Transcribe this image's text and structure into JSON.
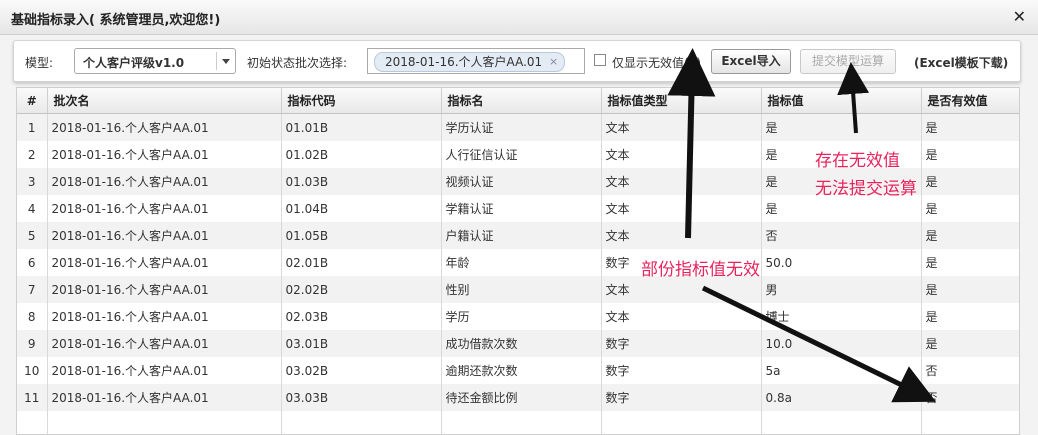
{
  "window": {
    "title": "基础指标录入( 系统管理员,欢迎您!)",
    "close_label": "✕"
  },
  "toolbar": {
    "model_label": "模型:",
    "model_value": "个人客户评级v1.0",
    "batch_label": "初始状态批次选择:",
    "batch_tag": "2018-01-16.个人客户AA.01",
    "tag_remove": "×",
    "invalid_only_label": "仅显示无效值(2)",
    "excel_import": "Excel导入",
    "submit_model": "提交模型运算",
    "excel_template": "(Excel模板下载)"
  },
  "table": {
    "columns": [
      "#",
      "批次名",
      "指标代码",
      "指标名",
      "指标值类型",
      "指标值",
      "是否有效值"
    ],
    "rows": [
      [
        "1",
        "2018-01-16.个人客户AA.01",
        "01.01B",
        "学历认证",
        "文本",
        "是",
        "是"
      ],
      [
        "2",
        "2018-01-16.个人客户AA.01",
        "01.02B",
        "人行征信认证",
        "文本",
        "是",
        "是"
      ],
      [
        "3",
        "2018-01-16.个人客户AA.01",
        "01.03B",
        "视频认证",
        "文本",
        "是",
        "是"
      ],
      [
        "4",
        "2018-01-16.个人客户AA.01",
        "01.04B",
        "学籍认证",
        "文本",
        "是",
        "是"
      ],
      [
        "5",
        "2018-01-16.个人客户AA.01",
        "01.05B",
        "户籍认证",
        "文本",
        "否",
        "是"
      ],
      [
        "6",
        "2018-01-16.个人客户AA.01",
        "02.01B",
        "年龄",
        "数字",
        "50.0",
        "是"
      ],
      [
        "7",
        "2018-01-16.个人客户AA.01",
        "02.02B",
        "性别",
        "文本",
        "男",
        "是"
      ],
      [
        "8",
        "2018-01-16.个人客户AA.01",
        "02.03B",
        "学历",
        "文本",
        "博士",
        "是"
      ],
      [
        "9",
        "2018-01-16.个人客户AA.01",
        "03.01B",
        "成功借款次数",
        "数字",
        "10.0",
        "是"
      ],
      [
        "10",
        "2018-01-16.个人客户AA.01",
        "03.02B",
        "逾期还款次数",
        "数字",
        "5a",
        "否"
      ],
      [
        "11",
        "2018-01-16.个人客户AA.01",
        "03.03B",
        "待还金额比例",
        "数字",
        "0.8a",
        "否"
      ]
    ]
  },
  "annotations": {
    "note1_line1": "存在无效值",
    "note1_line2": "无法提交运算",
    "note2": "部份指标值无效",
    "color": "#e8245e"
  }
}
